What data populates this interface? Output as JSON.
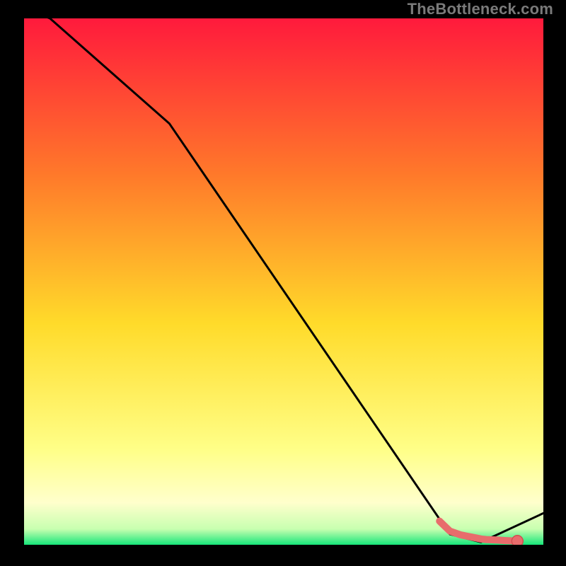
{
  "watermark": "TheBottleneck.com",
  "colors": {
    "background_black": "#000000",
    "gradient_top": "#ff1a3c",
    "gradient_upper_mid": "#ff7a2a",
    "gradient_mid": "#ffdb2a",
    "gradient_lower": "#ffff99",
    "gradient_bottom": "#17e67a",
    "curve_stroke": "#000000",
    "marker_fill": "#e86c6c",
    "marker_stroke": "#d04f4f"
  },
  "chart_data": {
    "type": "line",
    "title": "",
    "xlabel": "",
    "ylabel": "",
    "xlim": [
      0,
      100
    ],
    "ylim": [
      0,
      100
    ],
    "x": [
      0,
      5,
      28,
      82,
      88,
      100
    ],
    "values": [
      102,
      100,
      80,
      2,
      0.5,
      6
    ],
    "marker_curve": {
      "x": [
        80,
        82,
        84,
        85.5,
        87,
        88,
        89,
        91,
        92.5,
        95
      ],
      "y": [
        4.5,
        2.6,
        1.9,
        1.6,
        1.3,
        1.1,
        1.0,
        0.9,
        0.8,
        0.7
      ]
    },
    "single_marker": {
      "x": 95,
      "y": 0.7
    }
  }
}
